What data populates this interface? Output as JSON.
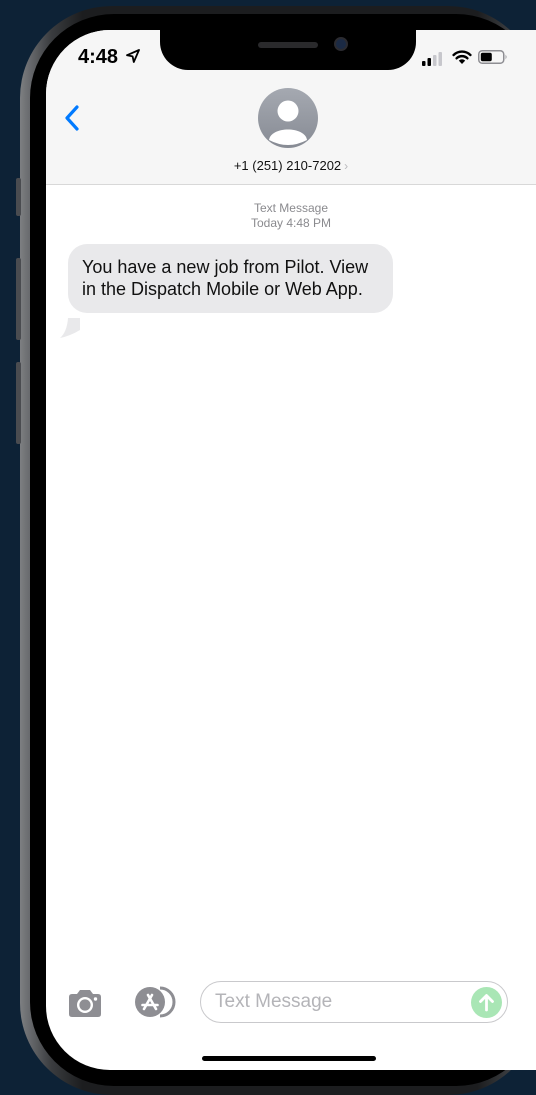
{
  "status_bar": {
    "time": "4:48",
    "icons": [
      "location-arrow-icon",
      "cellular-signal-icon",
      "wifi-icon",
      "battery-icon"
    ]
  },
  "header": {
    "back_icon": "chevron-left-icon",
    "avatar_icon": "person-silhouette-icon",
    "contact": "+1 (251) 210-7202",
    "contact_chevron": "›"
  },
  "conversation": {
    "service_label": "Text Message",
    "timestamp": "Today 4:48 PM",
    "messages": [
      {
        "direction": "incoming",
        "text": "You have a new job from Pilot. View  in the Dispatch Mobile or Web App."
      }
    ]
  },
  "compose": {
    "placeholder": "Text Message",
    "value": "",
    "camera_icon": "camera-icon",
    "apps_icon": "app-store-icon",
    "send_icon": "arrow-up-icon"
  },
  "colors": {
    "accent": "#007aff",
    "incoming_bubble": "#e9e9eb",
    "send_button_disabled": "#a9e6b5",
    "header_background": "#f6f6f6"
  }
}
